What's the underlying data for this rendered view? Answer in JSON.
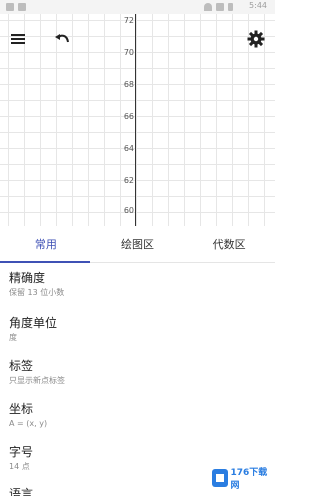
{
  "status_bar": {
    "time": "5:44"
  },
  "graph": {
    "y_ticks": [
      "72",
      "70",
      "68",
      "66",
      "64",
      "62",
      "60"
    ]
  },
  "toolbar": {
    "menu_icon": "menu-icon",
    "undo_icon": "undo-icon",
    "settings_icon": "gear-icon"
  },
  "tabs": [
    {
      "label": "常用",
      "active": true
    },
    {
      "label": "绘图区",
      "active": false
    },
    {
      "label": "代数区",
      "active": false
    }
  ],
  "settings": [
    {
      "title": "精确度",
      "value": "保留 13 位小数"
    },
    {
      "title": "角度单位",
      "value": "度"
    },
    {
      "title": "标签",
      "value": "只显示新点标签"
    },
    {
      "title": "坐标",
      "value": "A = (x, y)"
    },
    {
      "title": "字号",
      "value": "14 点"
    },
    {
      "title": "语言",
      "value": ""
    }
  ],
  "watermark": {
    "text": "176下载网"
  },
  "colors": {
    "accent": "#3f51b5",
    "axis": "#333333",
    "grid": "#e6e6e6"
  }
}
